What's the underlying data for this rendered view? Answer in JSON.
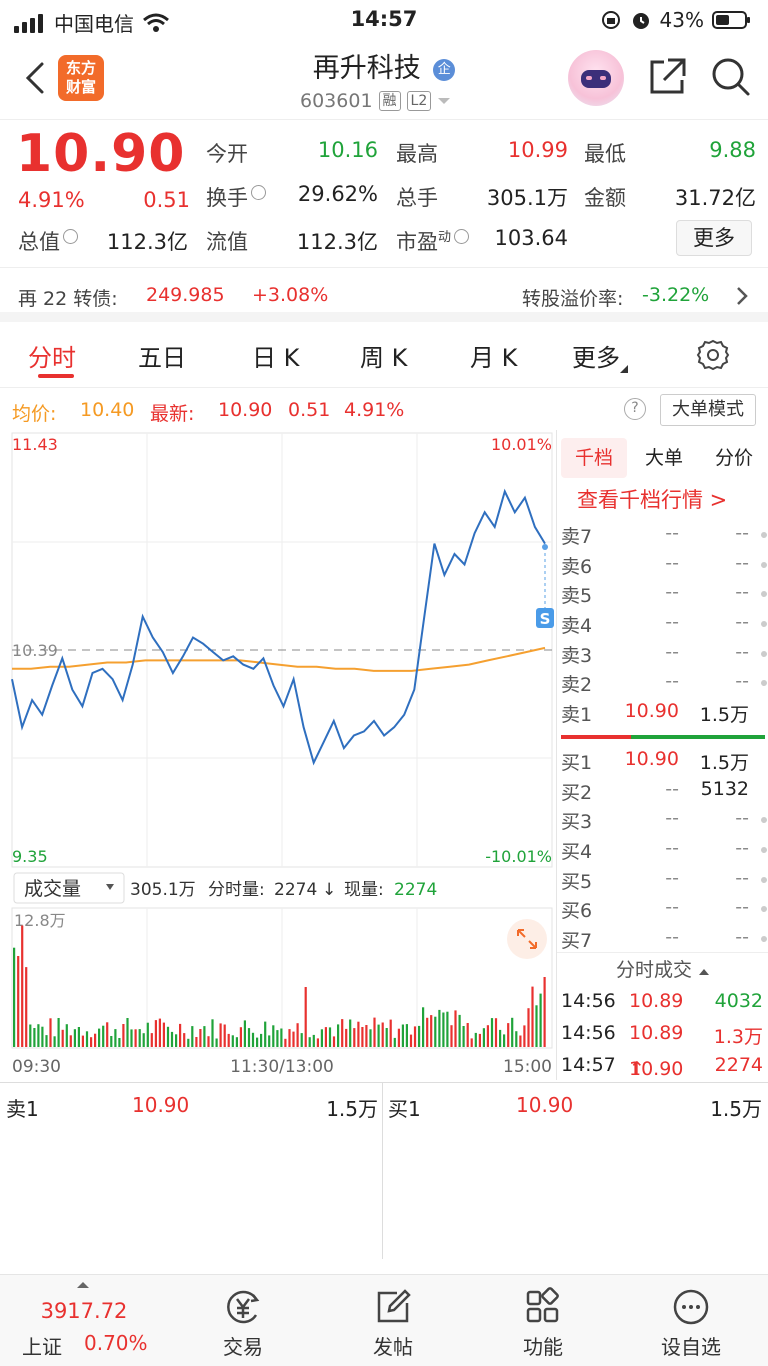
{
  "status_bar": {
    "carrier": "中国电信",
    "time": "14:57",
    "battery": "43%"
  },
  "header": {
    "logo_line1": "东方",
    "logo_line2": "财富",
    "stock_name": "再升科技",
    "badge": "企",
    "stock_code": "603601",
    "tag_rong": "融",
    "tag_l2": "L2"
  },
  "quote": {
    "price": "10.90",
    "change_pct": "4.91%",
    "change": "0.51",
    "rows": [
      [
        {
          "label": "今开",
          "value": "10.16",
          "color": "green"
        },
        {
          "label": "最高",
          "value": "10.99",
          "color": "red"
        },
        {
          "label": "最低",
          "value": "9.88",
          "color": "green"
        }
      ],
      [
        {
          "label": "换手",
          "value": "29.62%",
          "color": "dark"
        },
        {
          "label": "总手",
          "value": "305.1万",
          "color": "dark"
        },
        {
          "label": "金额",
          "value": "31.72亿",
          "color": "dark"
        }
      ]
    ],
    "total_value_label": "总值",
    "total_value": "112.3亿",
    "float_label": "流值",
    "float_value": "112.3亿",
    "pe_label": "市盈",
    "pe_sup": "动",
    "pe_value": "103.64",
    "more_label": "更多"
  },
  "bond": {
    "name": "再 22 转债:",
    "price": "249.985",
    "change": "+3.08%",
    "premium_label": "转股溢价率:",
    "premium_value": "-3.22%"
  },
  "tabs": [
    "分时",
    "五日",
    "日 K",
    "周 K",
    "月 K",
    "更多"
  ],
  "info_line": {
    "avg_label": "均价:",
    "avg_value": "10.40",
    "latest_label": "最新:",
    "latest_value": "10.90",
    "latest_change": "0.51",
    "latest_pct": "4.91%",
    "help": "?",
    "mode_label": "大单模式"
  },
  "chart": {
    "y_top": "11.43",
    "y_bottom": "9.35",
    "y_mid": "10.39",
    "pct_top": "10.01%",
    "pct_bottom": "-10.01%",
    "s_marker": "S",
    "x_labels": [
      "09:30",
      "11:30/13:00",
      "15:00"
    ],
    "vol_selector": "成交量",
    "vol_summary_total": "305.1万",
    "vol_summary_label": "分时量:",
    "vol_summary_value": "2274",
    "vol_arrow": "↓",
    "now_vol_label": "现量:",
    "now_vol_value": "2274",
    "vol_max": "12.8万"
  },
  "chart_data": {
    "type": "line",
    "title": "",
    "ylim": [
      9.35,
      11.43
    ],
    "prev_close": 10.39,
    "x_labels": [
      "09:30",
      "11:30/13:00",
      "15:00"
    ],
    "series": [
      {
        "values": [
          10.25,
          10.02,
          10.15,
          10.08,
          10.22,
          10.35,
          10.2,
          10.12,
          10.28,
          10.3,
          10.25,
          10.15,
          10.32,
          10.55,
          10.45,
          10.38,
          10.28,
          10.36,
          10.45,
          10.42,
          10.38,
          10.34,
          10.36,
          10.32,
          10.3,
          10.35,
          10.22,
          10.12,
          10.25,
          10.02,
          9.85,
          9.95,
          10.05,
          9.92,
          9.98,
          10.0,
          10.05,
          9.98,
          10.02,
          10.08,
          10.2,
          10.55,
          10.9,
          10.75,
          10.85,
          10.8,
          10.95,
          11.05,
          10.98,
          11.15,
          11.05,
          11.12,
          10.98,
          10.9
        ]
      },
      {
        "values": [
          10.3,
          10.3,
          10.31,
          10.31,
          10.32,
          10.33,
          10.33,
          10.34,
          10.34,
          10.34,
          10.34,
          10.34,
          10.34,
          10.33,
          10.32,
          10.31,
          10.31,
          10.3,
          10.3,
          10.29,
          10.29,
          10.29,
          10.3,
          10.31,
          10.32,
          10.34,
          10.36,
          10.38,
          10.4
        ]
      }
    ]
  },
  "orderbook": {
    "tabs": [
      "千档",
      "大单",
      "分价"
    ],
    "link": "查看千档行情 >",
    "sell": [
      {
        "lvl": "卖7",
        "price": "--",
        "vol": "--"
      },
      {
        "lvl": "卖6",
        "price": "--",
        "vol": "--"
      },
      {
        "lvl": "卖5",
        "price": "--",
        "vol": "--"
      },
      {
        "lvl": "卖4",
        "price": "--",
        "vol": "--"
      },
      {
        "lvl": "卖3",
        "price": "--",
        "vol": "--"
      },
      {
        "lvl": "卖2",
        "price": "--",
        "vol": "--"
      },
      {
        "lvl": "卖1",
        "price": "10.90",
        "vol": "1.5万"
      }
    ],
    "buy": [
      {
        "lvl": "买1",
        "price": "10.90",
        "vol": "1.5万"
      },
      {
        "lvl": "买2",
        "price": "--",
        "vol": "5132"
      },
      {
        "lvl": "买3",
        "price": "--",
        "vol": "--"
      },
      {
        "lvl": "买4",
        "price": "--",
        "vol": "--"
      },
      {
        "lvl": "买5",
        "price": "--",
        "vol": "--"
      },
      {
        "lvl": "买6",
        "price": "--",
        "vol": "--"
      },
      {
        "lvl": "买7",
        "price": "--",
        "vol": "--"
      }
    ],
    "ticks_title": "分时成交",
    "ticks": [
      {
        "time": "14:56",
        "price": "10.89",
        "vol": "4032",
        "vol_color": "green",
        "arrow": ""
      },
      {
        "time": "14:56",
        "price": "10.89",
        "vol": "1.3万",
        "vol_color": "red",
        "arrow": ""
      },
      {
        "time": "14:57",
        "price": "10.90",
        "vol": "2274",
        "vol_color": "red",
        "arrow": "↑"
      }
    ]
  },
  "bottom_quote": {
    "left": {
      "label": "卖1",
      "price": "10.90",
      "vol": "1.5万"
    },
    "right": {
      "label": "买1",
      "price": "10.90",
      "vol": "1.5万"
    }
  },
  "bottom_nav": {
    "index_value": "3917.72",
    "index_name": "上证",
    "index_pct": "0.70%",
    "items": [
      "交易",
      "发帖",
      "功能",
      "设自选"
    ]
  },
  "colors": {
    "up": "#e8312f",
    "down": "#20a33a",
    "price_line": "#2f6fbf",
    "avg_line": "#f5a030"
  }
}
